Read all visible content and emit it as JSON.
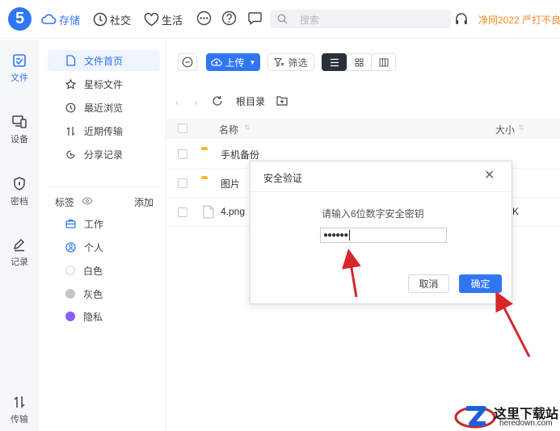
{
  "app": {
    "logo_glyph": "5",
    "accent": "#2f77f1"
  },
  "topnav": [
    {
      "id": "storage",
      "label": "存储",
      "icon": "cloud-icon",
      "active": true
    },
    {
      "id": "social",
      "label": "社交",
      "icon": "clock-icon",
      "active": false
    },
    {
      "id": "life",
      "label": "生活",
      "icon": "heart-icon",
      "active": false
    }
  ],
  "search": {
    "placeholder": "搜索"
  },
  "promo": {
    "text": "净网2022 严打不良"
  },
  "rail": [
    {
      "id": "files",
      "label": "文件",
      "icon": "file-icon",
      "active": true
    },
    {
      "id": "devices",
      "label": "设备",
      "icon": "devices-icon",
      "active": false
    },
    {
      "id": "vault",
      "label": "密档",
      "icon": "shield-icon",
      "active": false
    },
    {
      "id": "notes",
      "label": "记录",
      "icon": "pen-icon",
      "active": false
    },
    {
      "id": "transfer",
      "label": "传输",
      "icon": "transfer-icon",
      "active": false
    }
  ],
  "sidebar": {
    "items": [
      {
        "id": "home",
        "label": "文件首页",
        "icon": "file-icon",
        "active": true
      },
      {
        "id": "starred",
        "label": "星标文件",
        "icon": "star-icon",
        "active": false
      },
      {
        "id": "recent",
        "label": "最近浏览",
        "icon": "history-icon",
        "active": false
      },
      {
        "id": "transfers",
        "label": "近期传输",
        "icon": "transfer-icon",
        "active": false
      },
      {
        "id": "shares",
        "label": "分享记录",
        "icon": "share-record-icon",
        "active": false
      }
    ],
    "tags_header": "标签",
    "tags_add": "添加",
    "tags": [
      {
        "id": "work",
        "label": "工作",
        "icon": "briefcase-icon",
        "color": "#2f77f1"
      },
      {
        "id": "personal",
        "label": "个人",
        "icon": "person-icon",
        "color": "#2f77f1"
      },
      {
        "id": "white",
        "label": "白色",
        "icon": "white-dot-icon",
        "color": "#ffffff"
      },
      {
        "id": "gray",
        "label": "灰色",
        "icon": "gray-dot-icon",
        "color": "#c4c4c4"
      },
      {
        "id": "private",
        "label": "隐私",
        "icon": "purple-dot-icon",
        "color": "#8b5cf6"
      }
    ]
  },
  "toolbar": {
    "upload_label": "上传",
    "filter_label": "筛选",
    "view_mode": "list"
  },
  "breadcrumb": {
    "root": "根目录"
  },
  "table": {
    "columns": {
      "name": "名称",
      "size": "大小"
    },
    "rows": [
      {
        "name": "手机备份",
        "type": "folder",
        "size": ""
      },
      {
        "name": "图片",
        "type": "folder",
        "size": ""
      },
      {
        "name": "4.png",
        "type": "file",
        "size": "K"
      }
    ]
  },
  "dialog": {
    "title": "安全验证",
    "prompt": "请输入6位数字安全密钥",
    "masked_value": "●●●●●●",
    "cancel_label": "取消",
    "ok_label": "确定"
  },
  "watermark": {
    "title": "这里下载站",
    "url": "heredown.com"
  }
}
